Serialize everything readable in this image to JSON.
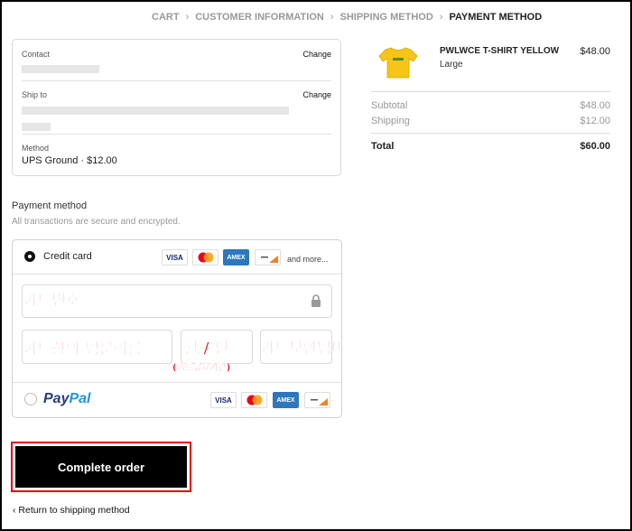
{
  "breadcrumb": [
    {
      "label": "CART",
      "active": false
    },
    {
      "label": "CUSTOMER INFORMATION",
      "active": false
    },
    {
      "label": "SHIPPING METHOD",
      "active": false
    },
    {
      "label": "PAYMENT METHOD",
      "active": true
    }
  ],
  "info": {
    "contact_label": "Contact",
    "ship_to_label": "Ship to",
    "change_label": "Change",
    "method_label": "Method",
    "method_value": "UPS Ground · $12.00"
  },
  "summary": {
    "product_name": "PWLWCE T-SHIRT YELLOW",
    "product_variant": "Large",
    "product_price": "$48.00",
    "subtotal_label": "Subtotal",
    "subtotal_value": "$48.00",
    "shipping_label": "Shipping",
    "shipping_value": "$12.00",
    "total_label": "Total",
    "total_value": "$60.00"
  },
  "payment": {
    "title": "Payment method",
    "subtitle": "All transactions are secure and encrypted.",
    "credit_card_label": "Credit card",
    "and_more": "and more...",
    "visa": "VISA",
    "amex": "AMEX",
    "paypal_part1": "Pay",
    "paypal_part2": "Pal",
    "hint_card_number": "카드번호",
    "hint_name": "카드상의 영문이름",
    "hint_expiry": "월 / 년",
    "hint_expiry_sub": "(카드유효기간)",
    "hint_security": "카드보안넘버"
  },
  "actions": {
    "complete_order": "Complete order",
    "return_link": "Return to shipping method"
  },
  "colors": {
    "accent_red": "#e8000c",
    "button_black": "#000000",
    "shirt_yellow": "#f5c518"
  }
}
